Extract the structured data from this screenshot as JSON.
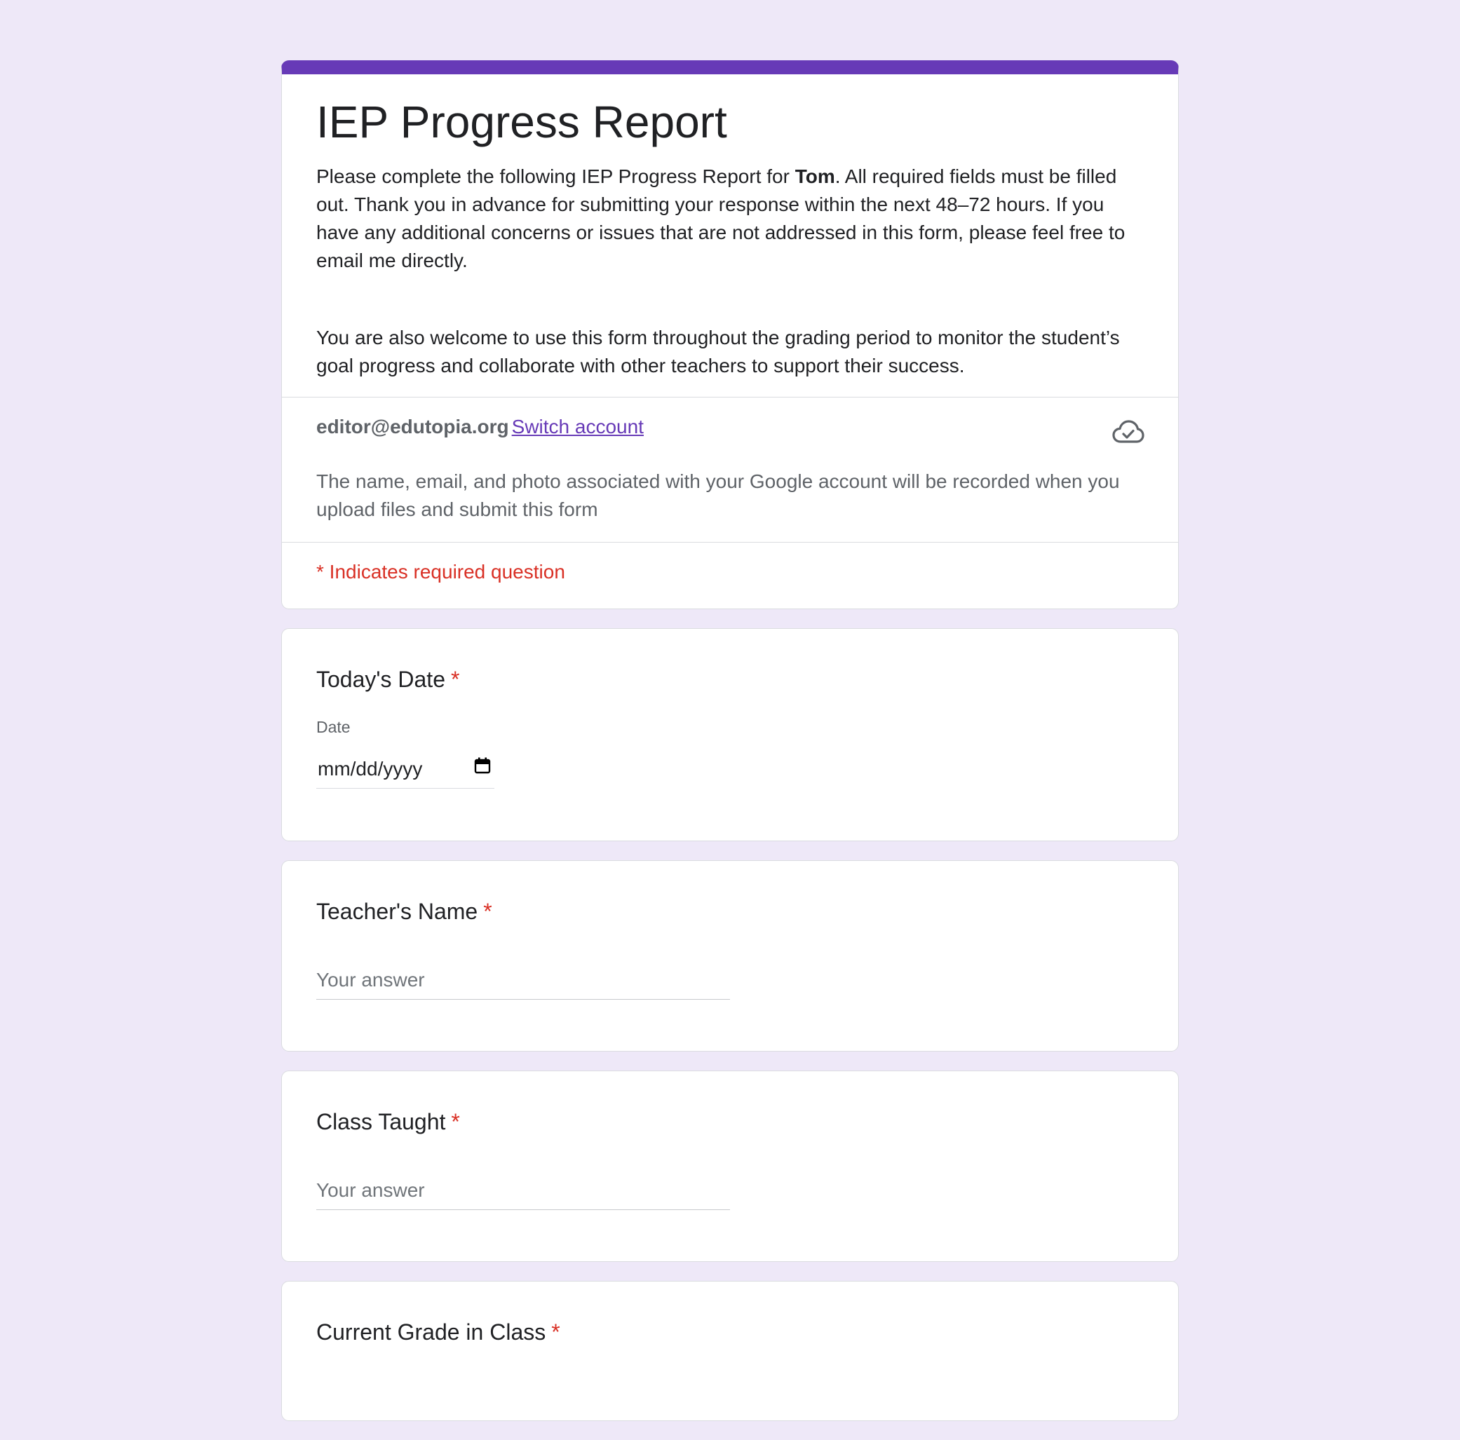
{
  "form": {
    "title": "IEP Progress Report",
    "description_part1": "Please complete the following IEP Progress Report for ",
    "student_name": "Tom",
    "description_part2": ". All required fields must be filled out. Thank you in advance for submitting your response within the next 48–72 hours. If you have any additional concerns or issues that are not addressed in this form, please feel free to email me directly.",
    "description_para2": "You are also welcome to use this form throughout the grading period to monitor the student’s goal progress and collaborate with other teachers to support their success."
  },
  "account": {
    "email": "editor@edutopia.org",
    "switch_label": "Switch account",
    "note": "The name, email, and photo associated with your Google account will be recorded when you upload files and submit this form",
    "cloud_icon": "cloud-check-icon"
  },
  "required_note": "* Indicates required question",
  "questions": [
    {
      "title": "Today's Date",
      "required_mark": "*",
      "type": "date",
      "sub_label": "Date",
      "value": "mm/dd/yyyy",
      "icon": "calendar-icon"
    },
    {
      "title": "Teacher's Name",
      "required_mark": "*",
      "type": "text",
      "placeholder": "Your answer"
    },
    {
      "title": "Class Taught",
      "required_mark": "*",
      "type": "text",
      "placeholder": "Your answer"
    },
    {
      "title": "Current Grade in Class",
      "required_mark": "*",
      "type": "text"
    }
  ],
  "colors": {
    "background": "#EEE8F8",
    "accent": "#673AB7",
    "required": "#d93025"
  }
}
